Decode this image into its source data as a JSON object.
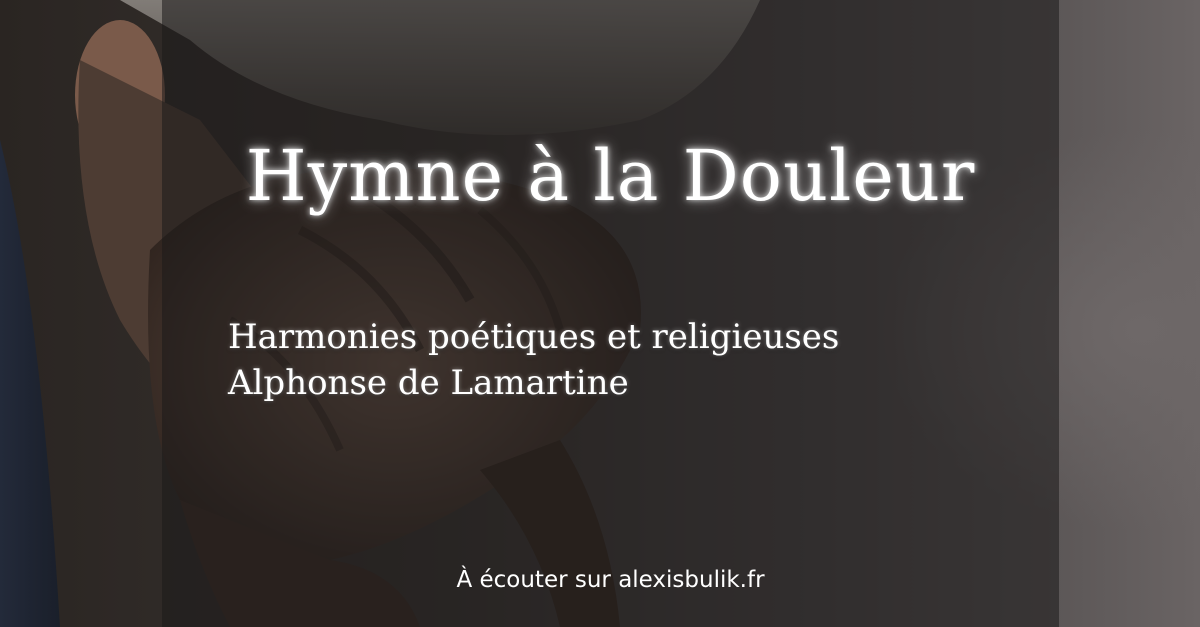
{
  "title": "Hymne à la Douleur",
  "collection": "Harmonies poétiques et religieuses",
  "author": "Alphonse de Lamartine",
  "cta": "À écouter sur alexisbulik.fr",
  "colors": {
    "text": "#ffffff",
    "overlay": "#1c1a1a"
  }
}
